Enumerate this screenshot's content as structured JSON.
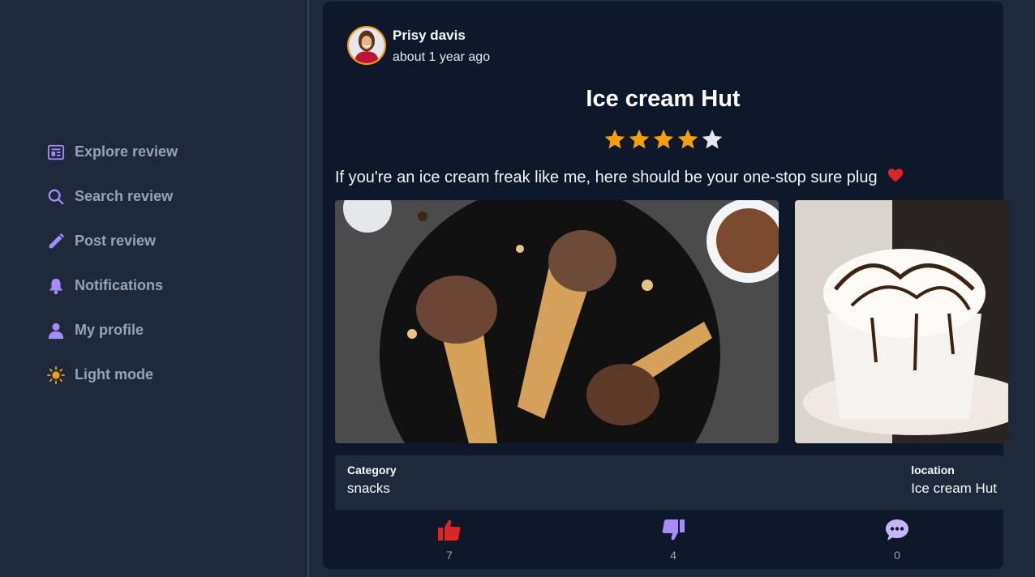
{
  "sidebar": {
    "items": [
      {
        "label": "Explore review",
        "icon": "newspaper-icon"
      },
      {
        "label": "Search review",
        "icon": "search-icon"
      },
      {
        "label": "Post review",
        "icon": "pencil-icon"
      },
      {
        "label": "Notifications",
        "icon": "bell-icon"
      },
      {
        "label": "My profile",
        "icon": "user-icon"
      },
      {
        "label": "Light mode",
        "icon": "sun-icon"
      }
    ]
  },
  "post": {
    "author": "Prisy davis",
    "time": "about 1 year ago",
    "title": "Ice cream Hut",
    "rating": 4,
    "rating_max": 5,
    "text": "If you're an ice cream freak like me, here should be your one-stop sure plug",
    "text_emoji": "heart-icon",
    "images": [
      "chocolate-ice-cream-cones-image",
      "whipped-cream-drink-image"
    ],
    "category_label": "Category",
    "category_value": "snacks",
    "location_label": "location",
    "location_value": "Ice cream Hut"
  },
  "actions": {
    "likes": "7",
    "dislikes": "4",
    "comments": "0"
  },
  "colors": {
    "accent": "#a78bfa",
    "star": "#f59e0b",
    "like": "#dc2626"
  }
}
